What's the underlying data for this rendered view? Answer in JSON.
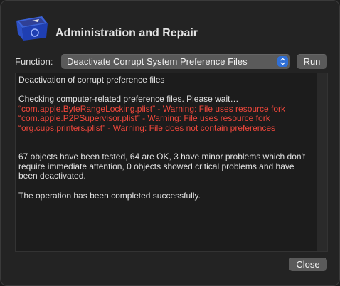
{
  "window": {
    "title": "Administration and Repair"
  },
  "function_row": {
    "label": "Function:",
    "selected": "Deactivate Corrupt System Preference Files",
    "run_label": "Run"
  },
  "log": {
    "heading": "Deactivation of corrupt preference files",
    "checking": "Checking computer-related preference files. Please wait…",
    "warnings": [
      "“com.apple.ByteRangeLocking.plist” - Warning: File uses resource fork",
      "“com.apple.P2PSupervisor.plist” - Warning: File uses resource fork",
      "“org.cups.printers.plist” - Warning: File does not contain preferences"
    ],
    "summary": "67 objects have been tested, 64 are OK, 3 have minor problems which don't require immediate attention, 0 objects showed critical problems and have been deactivated.",
    "result": "The operation has been completed successfully."
  },
  "footer": {
    "close_label": "Close"
  },
  "colors": {
    "warning": "#f0473c",
    "accent": "#2f6fd6"
  },
  "icons": {
    "app": "trash-bin-icon",
    "select": "chevron-up-down-icon"
  }
}
